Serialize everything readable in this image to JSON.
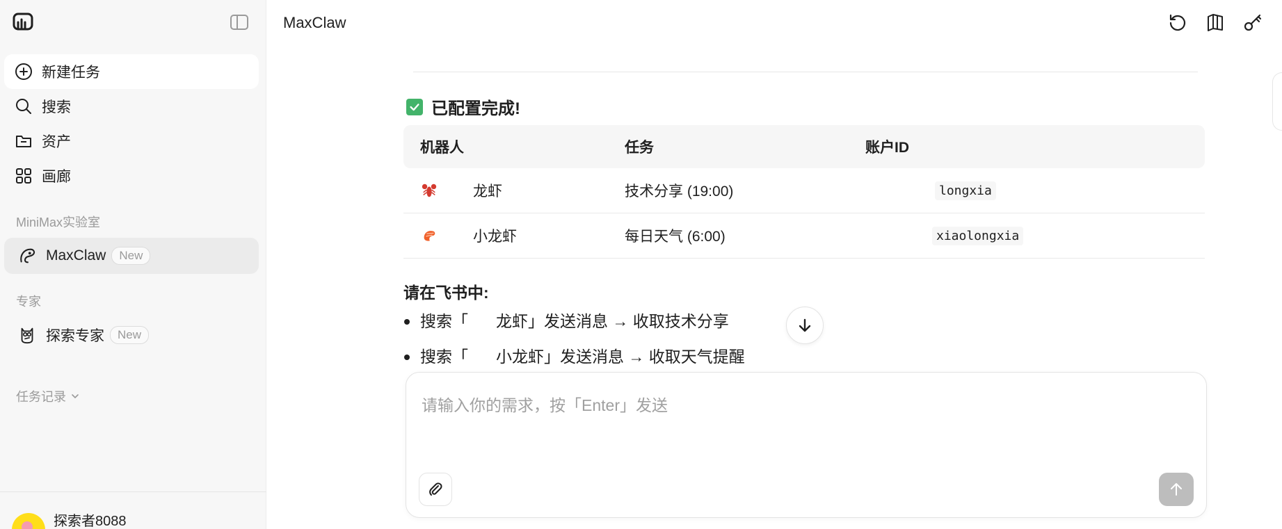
{
  "sidebar": {
    "nav": [
      {
        "label": "新建任务",
        "icon": "plus-circle-icon"
      },
      {
        "label": "搜索",
        "icon": "search-icon"
      },
      {
        "label": "资产",
        "icon": "folder-icon"
      },
      {
        "label": "画廊",
        "icon": "grid-icon"
      }
    ],
    "lab_section": "MiniMax实验室",
    "lab_item": {
      "label": "MaxClaw",
      "badge": "New"
    },
    "expert_section": "专家",
    "expert_item": {
      "label": "探索专家",
      "badge": "New"
    },
    "history_label": "任务记录",
    "user": {
      "name": "探索者8088"
    }
  },
  "header": {
    "title": "MaxClaw",
    "icons": [
      "history-icon",
      "book-icon",
      "key-icon"
    ]
  },
  "message": {
    "status": "已配置完成!",
    "table": {
      "headers": [
        "机器人",
        "任务",
        "账户ID"
      ],
      "rows": [
        {
          "emoji": "lobster-icon",
          "robot": "龙虾",
          "task": "技术分享 (19:00)",
          "account": "longxia"
        },
        {
          "emoji": "shrimp-icon",
          "robot": "小龙虾",
          "task": "每日天气 (6:00)",
          "account": "xiaolongxia"
        }
      ]
    },
    "instructions_title": "请在飞书中:",
    "bullets": [
      {
        "pre": "搜索「",
        "post": "龙虾」发送消息 → 收取技术分享"
      },
      {
        "pre": "搜索「",
        "post": "小龙虾」发送消息 → 收取天气提醒"
      }
    ]
  },
  "composer": {
    "placeholder": "请输入你的需求，按「Enter」发送"
  },
  "colors": {
    "accent_green": "#43b36a",
    "send_disabled": "#bdbdbd",
    "sidebar_bg": "#f7f7f7"
  }
}
